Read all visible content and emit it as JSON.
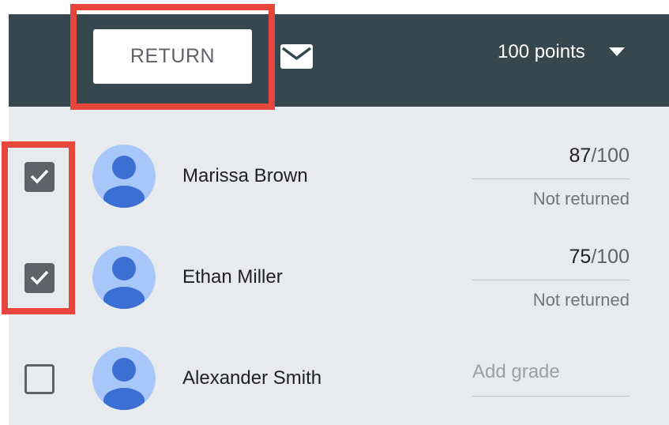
{
  "toolbar": {
    "return_label": "RETURN",
    "mail_icon": "mail-icon",
    "points_label": "100 points",
    "dropdown_icon": "caret-down-icon",
    "background_color": "#37474f"
  },
  "students": [
    {
      "name": "Marissa Brown",
      "checked": true,
      "grade": "87",
      "out_of": "/100",
      "status": "Not returned"
    },
    {
      "name": "Ethan Miller",
      "checked": true,
      "grade": "75",
      "out_of": "/100",
      "status": "Not returned"
    },
    {
      "name": "Alexander Smith",
      "checked": false,
      "grade_placeholder": "Add grade"
    }
  ],
  "colors": {
    "highlight": "#e8453c",
    "avatar_bg": "#a7c7fa",
    "avatar_fg": "#3b6fd4",
    "list_bg": "#e8eaed"
  }
}
